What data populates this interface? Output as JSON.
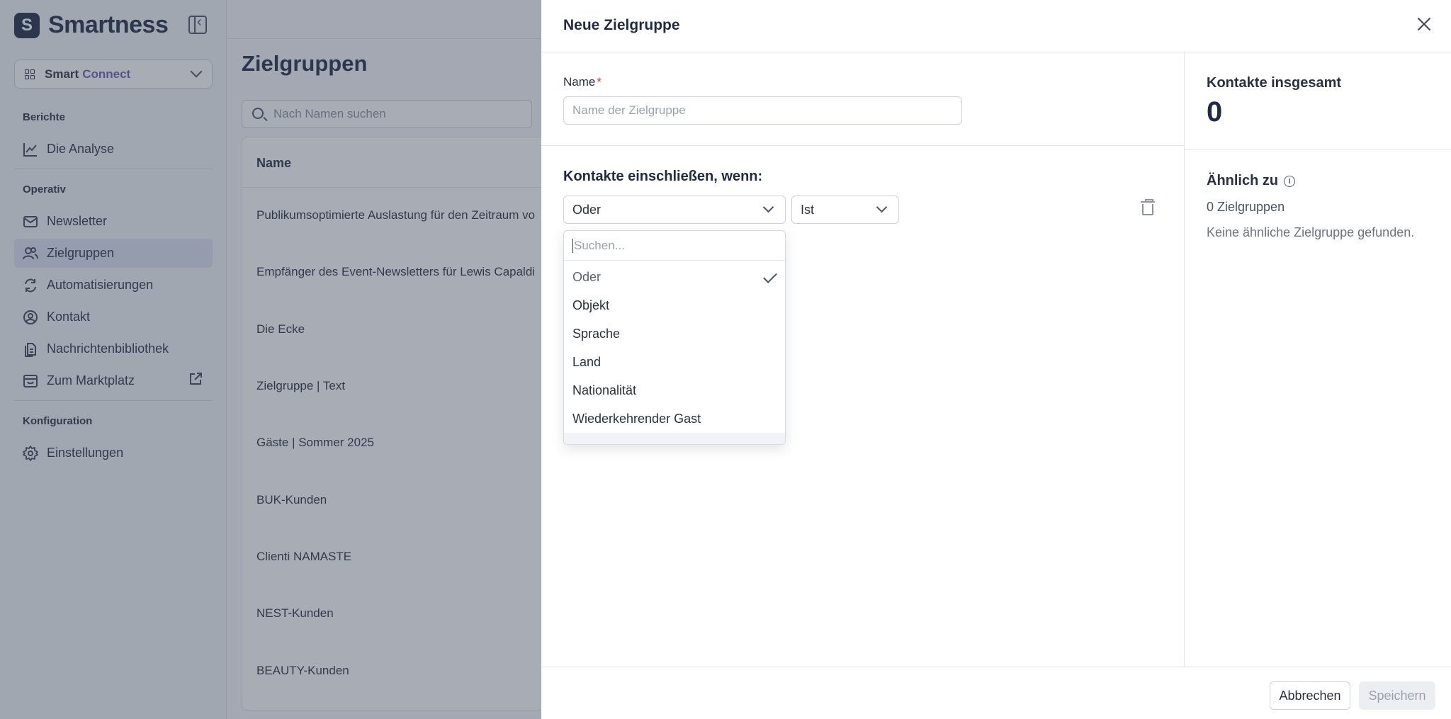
{
  "app": {
    "logo_text": "Smartness",
    "logo_letter": "S",
    "product_prefix": "Smart",
    "product_suffix": "Connect"
  },
  "sidebar": {
    "sections": [
      {
        "label": "Berichte"
      },
      {
        "label": "Operativ"
      },
      {
        "label": "Konfiguration"
      }
    ],
    "items": [
      {
        "label": "Die Analyse",
        "icon": "chart-line-icon"
      },
      {
        "label": "Newsletter",
        "icon": "mail-icon"
      },
      {
        "label": "Zielgruppen",
        "icon": "users-icon",
        "active": true
      },
      {
        "label": "Automatisierungen",
        "icon": "refresh-icon"
      },
      {
        "label": "Kontakt",
        "icon": "user-circle-icon"
      },
      {
        "label": "Nachrichtenbibliothek",
        "icon": "files-icon"
      },
      {
        "label": "Zum Marktplatz",
        "icon": "store-icon",
        "external": true
      },
      {
        "label": "Einstellungen",
        "icon": "gear-icon"
      }
    ]
  },
  "main": {
    "title": "Zielgruppen",
    "search_placeholder": "Nach Namen suchen",
    "table": {
      "header_name": "Name",
      "rows": [
        "Publikumsoptimierte Auslastung für den Zeitraum vo",
        "Empfänger des Event-Newsletters für Lewis Capaldi",
        "Die Ecke",
        "Zielgruppe | Text",
        "Gäste | Sommer 2025",
        "BUK-Kunden",
        "Clienti NAMASTE",
        "NEST-Kunden",
        "BEAUTY-Kunden"
      ]
    }
  },
  "drawer": {
    "title": "Neue Zielgruppe",
    "name_label": "Name",
    "required_mark": "*",
    "name_placeholder": "Name der Zielgruppe",
    "rules_title": "Kontakte einschließen, wenn:",
    "field_select_value": "Oder",
    "operator_select_value": "Ist",
    "dropdown": {
      "search_placeholder": "Suchen...",
      "options": [
        {
          "label": "Oder",
          "selected": true
        },
        {
          "label": "Objekt"
        },
        {
          "label": "Sprache"
        },
        {
          "label": "Land"
        },
        {
          "label": "Nationalität"
        },
        {
          "label": "Wiederkehrender Gast"
        }
      ]
    },
    "summary": {
      "total_label": "Kontakte insgesamt",
      "total_value": "0",
      "similar_title": "Ähnlich zu",
      "similar_count": "0 Zielgruppen",
      "similar_empty": "Keine ähnliche Zielgruppe gefunden."
    },
    "footer": {
      "cancel_label": "Abbrechen",
      "save_label": "Speichern"
    }
  },
  "colors": {
    "accent": "#6b5fb5",
    "nav_active_bg": "#dfe2f0",
    "required": "#d8323c",
    "text_primary": "#1f2a44"
  }
}
